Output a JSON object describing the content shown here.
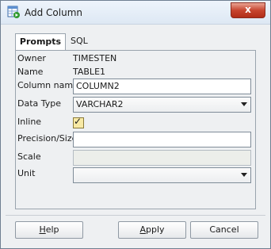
{
  "window": {
    "title": "Add Column",
    "close_label": "x"
  },
  "tabs": [
    {
      "label": "Prompts",
      "active": true
    },
    {
      "label": "SQL",
      "active": false
    }
  ],
  "form": {
    "owner": {
      "label": "Owner",
      "value": "TIMESTEN"
    },
    "name": {
      "label": "Name",
      "value": "TABLE1"
    },
    "column_name": {
      "label": "Column name",
      "value": "COLUMN2"
    },
    "data_type": {
      "label": "Data Type",
      "value": "VARCHAR2"
    },
    "inline": {
      "label": "Inline",
      "checked": true
    },
    "precision_size": {
      "label": "Precision/Size",
      "value": ""
    },
    "scale": {
      "label": "Scale",
      "value": ""
    },
    "unit": {
      "label": "Unit",
      "value": ""
    }
  },
  "buttons": {
    "help": {
      "first": "H",
      "rest": "elp"
    },
    "apply": {
      "first": "A",
      "rest": "pply"
    },
    "cancel": "Cancel"
  }
}
